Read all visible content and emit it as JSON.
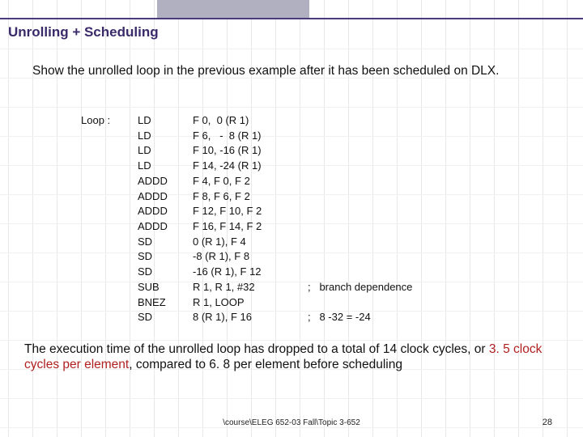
{
  "title": "Unrolling + Scheduling",
  "intro": "Show the unrolled loop in the previous example after it has been scheduled on DLX.",
  "code": {
    "label": "Loop :",
    "rows": [
      {
        "op": "LD",
        "args": "F 0,  0 (R 1)",
        "comment": ""
      },
      {
        "op": "LD",
        "args": "F 6,   -  8 (R 1)",
        "comment": ""
      },
      {
        "op": "LD",
        "args": "F 10, -16 (R 1)",
        "comment": ""
      },
      {
        "op": "LD",
        "args": "F 14, -24 (R 1)",
        "comment": ""
      },
      {
        "op": "ADDD",
        "args": "F 4, F 0, F 2",
        "comment": ""
      },
      {
        "op": "ADDD",
        "args": "F 8, F 6, F 2",
        "comment": ""
      },
      {
        "op": "ADDD",
        "args": "F 12, F 10, F 2",
        "comment": ""
      },
      {
        "op": "ADDD",
        "args": "F 16, F 14, F 2",
        "comment": ""
      },
      {
        "op": "SD",
        "args": "0 (R 1), F 4",
        "comment": ""
      },
      {
        "op": "SD",
        "args": "-8 (R 1), F 8",
        "comment": ""
      },
      {
        "op": "SD",
        "args": "-16 (R 1), F 12",
        "comment": ""
      },
      {
        "op": "SUB",
        "args": "R 1, R 1, #32",
        "comment": ";   branch dependence"
      },
      {
        "op": "BNEZ",
        "args": "R 1, LOOP",
        "comment": ""
      },
      {
        "op": "SD",
        "args": "8 (R 1), F 16",
        "comment": ";   8 -32 = -24"
      }
    ]
  },
  "conclusion_parts": {
    "p1": "The execution time of the unrolled loop has dropped to a total of 14 clock cycles, or ",
    "em": "3. 5 clock cycles per element",
    "p2": ", compared to 6. 8 per element before scheduling"
  },
  "footer_path": "\\course\\ELEG 652-03 Fall\\Topic 3-652",
  "page_number": "28"
}
